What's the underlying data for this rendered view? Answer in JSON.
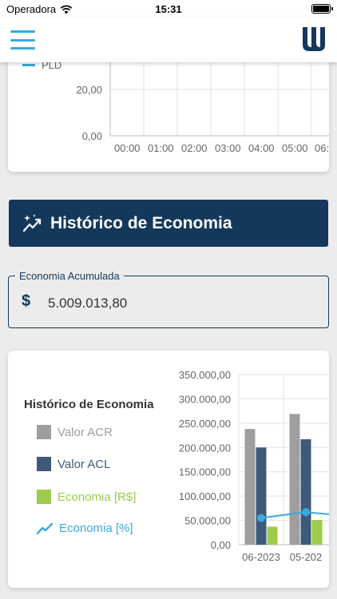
{
  "status_bar": {
    "carrier": "Operadora",
    "time": "15:31"
  },
  "top_chart": {
    "legend": "PLD",
    "y_ticks": [
      "20,00",
      "0,00"
    ],
    "x_ticks": [
      "00:00",
      "01:00",
      "02:00",
      "03:00",
      "04:00",
      "05:00",
      "06:"
    ]
  },
  "banner": {
    "title": "Histórico de Economia"
  },
  "accumulated": {
    "label": "Economia Acumulada",
    "value": "5.009.013,80"
  },
  "history_chart": {
    "title": "Histórico de Economia",
    "legend": [
      {
        "label": "Valor ACR",
        "color": "#9e9e9e"
      },
      {
        "label": "Valor ACL",
        "color": "#3f5a78"
      },
      {
        "label": "Economia [R$]",
        "color": "#9ccc4a"
      },
      {
        "label": "Economia [%]",
        "color": "#3aa9dc"
      }
    ],
    "y_ticks": [
      "350.000,00",
      "300.000,00",
      "250.000,00",
      "200.000,00",
      "150.000,00",
      "100.000,00",
      "50.000,00",
      "0,00"
    ],
    "x_labels": [
      "06-2023",
      "05-202"
    ]
  },
  "chart_data": {
    "type": "bar",
    "categories": [
      "06-2023",
      "05-202"
    ],
    "ylim": [
      0,
      350000
    ],
    "series": [
      {
        "name": "Valor ACR",
        "values": [
          238000,
          269000
        ]
      },
      {
        "name": "Valor ACL",
        "values": [
          200000,
          217000
        ]
      },
      {
        "name": "Economia [R$]",
        "values": [
          37000,
          51000
        ]
      },
      {
        "name": "Economia [%]",
        "values": [
          55000,
          67000
        ]
      }
    ]
  }
}
